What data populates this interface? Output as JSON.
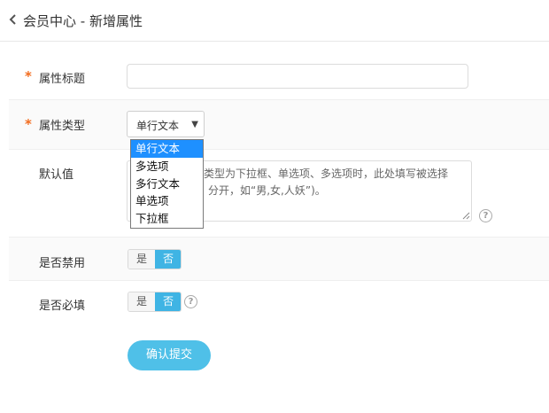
{
  "header": {
    "title": "会员中心 - 新增属性"
  },
  "form": {
    "title_field": {
      "label": "属性标题",
      "required_mark": "*",
      "value": ""
    },
    "type_field": {
      "label": "属性类型",
      "required_mark": "*",
      "selected": "单行文本",
      "options": [
        "单行文本",
        "多选项",
        "多行文本",
        "单选项",
        "下拉框"
      ]
    },
    "default_field": {
      "label": "默认值",
      "text": "类型为下拉框、单选项、多选项时，此处填写被选择分开，如“男,女,人妖”)。",
      "visible_line1": "类型为下拉框、单选项、多选项时，此处填写被选择",
      "visible_line2": "分开，如“男,女,人妖”)。",
      "help": "?"
    },
    "disabled_field": {
      "label": "是否禁用",
      "yes": "是",
      "no": "否",
      "selected": "否"
    },
    "required_field": {
      "label": "是否必填",
      "yes": "是",
      "no": "否",
      "selected": "否",
      "help": "?"
    }
  },
  "submit": {
    "label": "确认提交"
  },
  "colors": {
    "accent": "#3fb4e4",
    "button": "#4fc0e8",
    "required": "#f26b1d",
    "dropdown_selected": "#1e90ff"
  }
}
